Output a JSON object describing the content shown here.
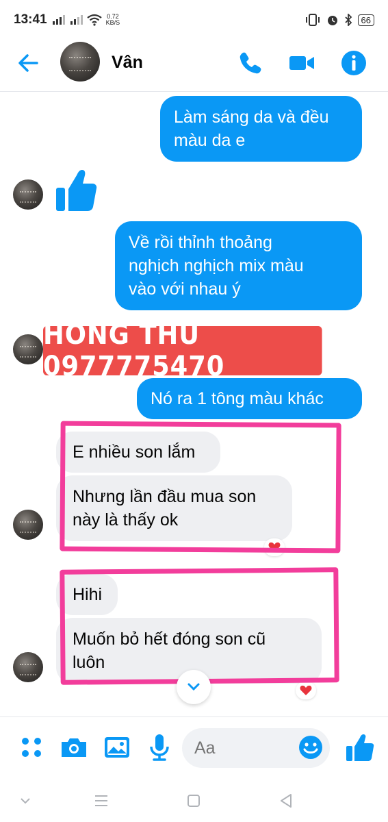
{
  "status_bar": {
    "time": "13:41",
    "net_speed_value": "0.72",
    "net_speed_unit": "KB/S",
    "battery": "66"
  },
  "header": {
    "contact_name": "Vân",
    "icons": [
      "back-arrow-icon",
      "phone-icon",
      "video-camera-icon",
      "info-icon"
    ]
  },
  "messages": [
    {
      "from": "me",
      "text_lines": [
        "Làm sáng da và đều",
        "màu da e"
      ]
    },
    {
      "from": "them",
      "type": "like",
      "icon": "thumbs-up-icon"
    },
    {
      "from": "me",
      "text_lines": [
        "Về rồi thỉnh thoảng",
        "nghịch nghịch mix màu",
        "vào với nhau ý"
      ]
    },
    {
      "from": "me",
      "text_lines": [
        "Nó ra 1 tông màu khác"
      ]
    },
    {
      "from": "them",
      "text_lines": [
        "E nhiều son lắm"
      ]
    },
    {
      "from": "them",
      "text_lines": [
        "Nhưng lần đầu mua son",
        "này là thấy ok"
      ],
      "reaction": "heart"
    },
    {
      "from": "them",
      "text_lines": [
        "Hihi"
      ]
    },
    {
      "from": "them",
      "text_lines": [
        "Muốn bỏ hết đóng son cũ",
        "luôn"
      ],
      "reaction": "heart"
    }
  ],
  "overlay": {
    "watermark_text": "HỒNG THU 0977775470",
    "watermark_color": "#ed4d4a",
    "highlight_color": "#f23d9b"
  },
  "composer": {
    "placeholder": "Aa",
    "icons": [
      "menu-dots-icon",
      "camera-icon",
      "gallery-icon",
      "microphone-icon",
      "emoji-icon",
      "thumbs-up-icon"
    ]
  },
  "colors": {
    "accent": "#0a98f5",
    "incoming_bubble": "#eeeff2",
    "outgoing_bubble": "#0a98f5"
  }
}
